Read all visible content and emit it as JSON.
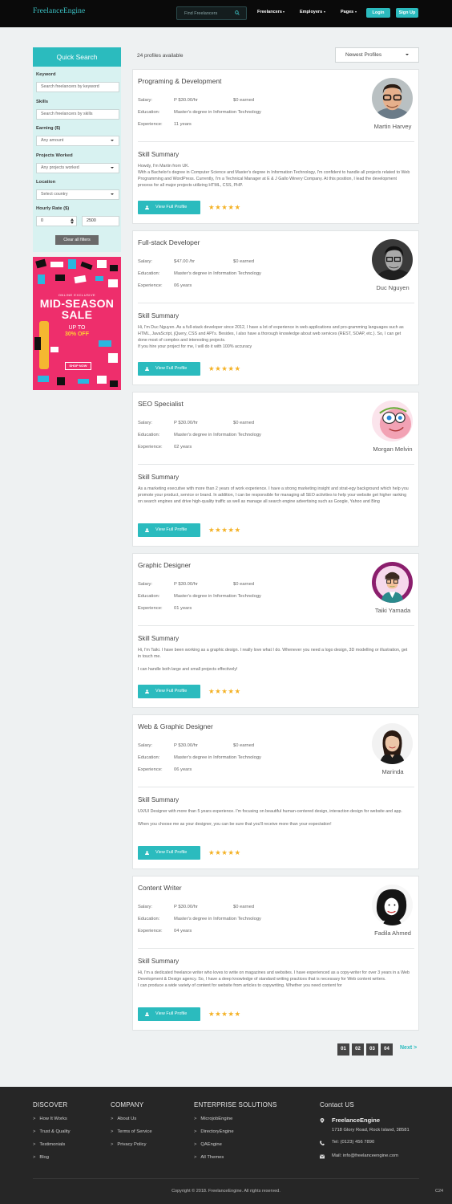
{
  "header": {
    "logo": "FreelanceEngine",
    "search_placeholder": "Find Freelancers",
    "nav": [
      "Freelancers",
      "Employers",
      "Pages"
    ],
    "login": "Login",
    "signup": "Sign Up"
  },
  "sidebar": {
    "title": "Quick Search",
    "keyword_label": "Keyword",
    "keyword_placeholder": "Search freelancers by keyword",
    "skills_label": "Skills",
    "skills_placeholder": "Search freelancers by skills",
    "earning_label": "Earning ($)",
    "earning_value": "Any amount",
    "projects_label": "Projects Worked",
    "projects_value": "Any projects worked",
    "location_label": "Location",
    "location_value": "Select country",
    "rate_label": "Hourly Rate ($)",
    "rate_min": "0",
    "rate_max": "2500",
    "clear": "Clear all filters"
  },
  "ad": {
    "exclusive": "ONLINE EXCLUSIVE",
    "headline_1": "MID-SEASON",
    "headline_2": "SALE",
    "upto": "UP TO",
    "off": "30% OFF",
    "shop": "SHOP NOW"
  },
  "main": {
    "count": "24 profiles available",
    "sort": "Newest Profiles",
    "labels": {
      "salary": "Salary:",
      "education": "Education:",
      "experience": "Experience:",
      "skill_summary": "Skill Summary",
      "view": "View Full Profile",
      "stars": "★★★★★"
    },
    "profiles": [
      {
        "title": "Programing & Development",
        "salary": "P $30.00/hr",
        "earned": "$0 earned",
        "education": "Master's degree in Information Technology",
        "experience": "11 years",
        "name": "Martin Harvey",
        "summary": "Howdy, I'm Martin from UK.\nWith a Bachelor's degree in Computer Science and Master's degree in Information Technology, I'm confident to handle all projects related to Web Programming and WordPress. Currently, I'm a Technical Manager at E & J Gallo Winery Company. At this position, I lead the development process for all major projects utilizing HTML, CSS, PHP."
      },
      {
        "title": "Full-stack Developer",
        "salary": "$47.00 /hr",
        "earned": "$0 earned",
        "education": "Master's degree in Information Technology",
        "experience": "06 years",
        "name": "Duc Nguyen",
        "summary": "Hi, I'm Duc Nguyen. As a full-stack developer since 2012, I have a lot of experience in web applications and pro-gramming languages such as HTML, JavaScript, jQuery, CSS and API's. Besides, I also have a thorough knowledge about web services (REST, SOAP, etc.). So, I can get done most of complex and  interesting projects.\nIf you hire your project for me, I will do it with 100% accuracy"
      },
      {
        "title": "SEO Specialist",
        "salary": "P $30.00/hr",
        "earned": "$0 earned",
        "education": "Master's degree in Information Technology",
        "experience": "02 years",
        "name": "Morgan Melvin",
        "summary": "As a marketing executive with more than 2 years of work experience. I have a strong marketing insight and strat-egy background which help you promote your  product, service or brand. In addition, I can be  responsible for managing all SEO activities to help your website get higher ranking on search engines and drive high-quality traffic as well as  manage all search engine advertising such as Google, Yahoo and Bing"
      },
      {
        "title": "Graphic Designer",
        "salary": "P $30.00/hr",
        "earned": "$0 earned",
        "education": "Master's degree in Information Technology",
        "experience": "01 years",
        "name": "Taiki Yamada",
        "summary": "Hi, I'm Taiki. I have been working as a graphic design. I really love what I do. Whenever you need a logo design, 3D modelling or illustration, get in touch me.\n\nI can handle both large and small projects effectively!"
      },
      {
        "title": "Web & Graphic Designer",
        "salary": "P $30.00/hr",
        "earned": "$0 earned",
        "education": "Master's degree in Information Technology",
        "experience": "06 years",
        "name": "Marinda",
        "summary": "UX/UI Designer with more than 5 years experience. I'm focusing on beautiful human-centered design, interaction design for website and app.\n\nWhen you choose me as your designer, you can be sure that you'll receive more than your expectation!"
      },
      {
        "title": "Content Writer",
        "salary": "P $30.00/hr",
        "earned": "$0 earned",
        "education": "Master's degree in Information Technology",
        "experience": "04 years",
        "name": "Fadila Ahmed",
        "summary": "Hi, I'm a dedicated freelance writer who loves to write on magazines and websites. I have experienced as a copy-writer for over 3 years in a Web Development & Design agency. So, I have a deep knowledge of standard writing practices that is necessary for Web content writers.\nI can produce a wide variety of content for website from articles to copywriting. Whether you need content for"
      }
    ]
  },
  "pagination": {
    "pages": [
      "01",
      "02",
      "03",
      "04"
    ],
    "next": "Next >"
  },
  "footer": {
    "discover": {
      "title": "DISCOVER",
      "links": [
        "How It Works",
        "Trust & Quality",
        "Testimonials",
        "Blog"
      ]
    },
    "company": {
      "title": "COMPANY",
      "links": [
        "About Us",
        "Terms of Service",
        "Privacy Policy"
      ]
    },
    "enterprise": {
      "title": "ENTERPRISE SOLUTIONS",
      "links": [
        "MicrojobEngine",
        "DirectoryEngine",
        "QAEngine",
        "All Themes"
      ]
    },
    "contact": {
      "title": "Contact US",
      "brand": "FreelanceEngine",
      "address": "1718 Glory Road, Rock Island, 38581",
      "tel": "Tel: (0123) 456 7890",
      "mail": "Mail: info@freelanceengine.com"
    },
    "copyright": "Copyright © 2018. FreelanceEngine. All rights reserved.",
    "code": "C24"
  },
  "colors": {
    "accent": "#2bbbbe",
    "star": "#f4b124",
    "header": "#0a0a0a",
    "footer": "#262626"
  }
}
